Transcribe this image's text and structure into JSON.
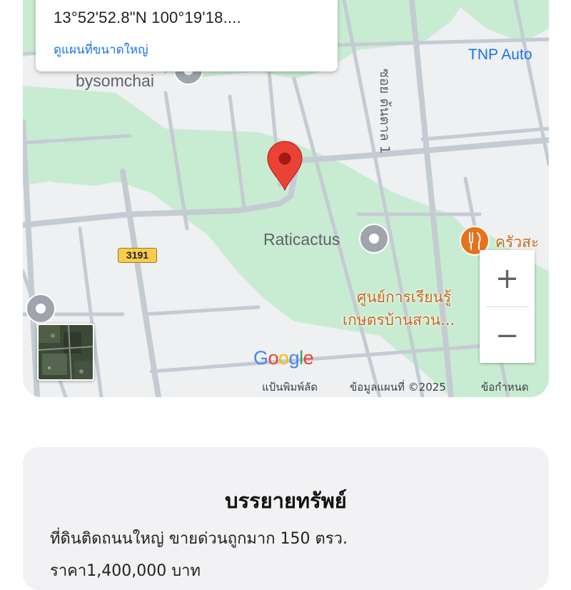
{
  "map": {
    "coords_text": "13°52'52.8\"N 100°19'18....",
    "view_larger_link": "ดูแผนที่ขนาดใหญ่",
    "poi_labels": {
      "bysomchai": "bysomchai",
      "raticactus": "Raticactus",
      "tnp": "TNP Auto",
      "krua": "ครัวสะ",
      "learning_center_line1": "ศูนย์การเรียนรู้",
      "learning_center_line2": "เกษตรบ้านสวน..."
    },
    "street_label": "ซอย ต้นตาล 1",
    "road_shield": "3191",
    "zoom_in": "+",
    "zoom_out": "−",
    "google_logo": "Google",
    "attribution": {
      "shortcuts": "แป้นพิมพ์ลัด",
      "map_data": "ข้อมูลแผนที่ ©2025",
      "terms": "ข้อกำหนด"
    },
    "colors": {
      "pin": "#ea4335",
      "green_area": "#c8ecd2",
      "road": "#c5cbd3",
      "base": "#eef0f2",
      "link": "#1a73e8",
      "poi_orange": "#e8711b"
    }
  },
  "description": {
    "title": "บรรยายทรัพย์",
    "line1": "ที่ดินติดถนนใหญ่ ขายด่วนถูกมาก 150 ตรว.",
    "line2": "ราคา1,400,000 บาท"
  }
}
